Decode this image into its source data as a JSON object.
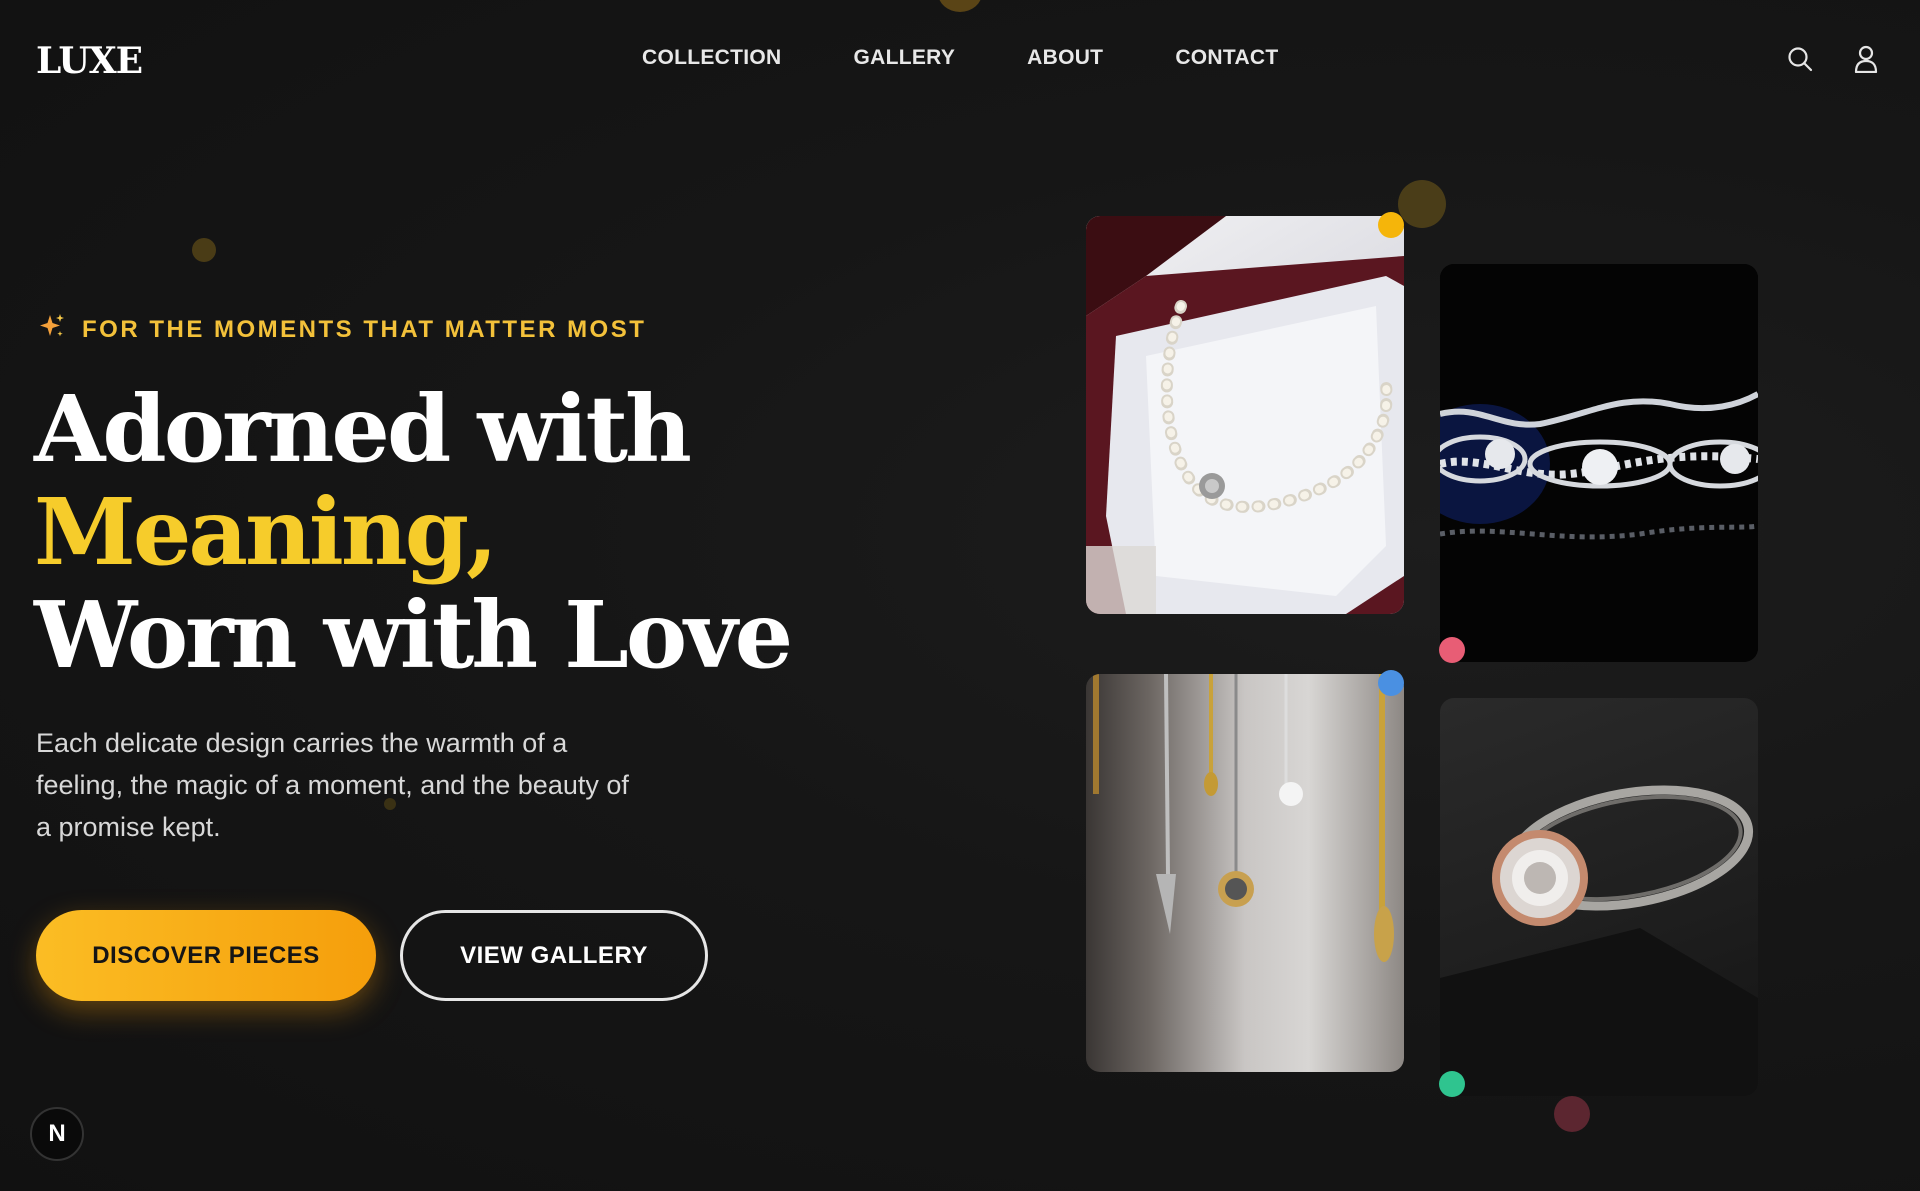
{
  "brand": {
    "logo": "LUXE"
  },
  "nav": {
    "items": [
      {
        "label": "COLLECTION"
      },
      {
        "label": "GALLERY"
      },
      {
        "label": "ABOUT"
      },
      {
        "label": "CONTACT"
      }
    ]
  },
  "header_icons": [
    "search-icon",
    "user-icon"
  ],
  "hero": {
    "tagline": "FOR THE MOMENTS THAT MATTER MOST",
    "tagline_icon": "sparkles-icon",
    "headline_line1": "Adorned with",
    "headline_accent": "Meaning,",
    "headline_line3": "Worn with Love",
    "subtext": "Each delicate design carries the warmth of a feeling, the magic of a moment, and the beauty of a promise kept.",
    "primary_button": "DISCOVER PIECES",
    "secondary_button": "VIEW GALLERY"
  },
  "gallery": {
    "cards": [
      {
        "name": "pearl-necklace-image"
      },
      {
        "name": "diamond-bracelet-image"
      },
      {
        "name": "hanging-pendants-image"
      },
      {
        "name": "rose-gold-ring-image"
      }
    ]
  },
  "dev_badge": {
    "label": "N"
  },
  "colors": {
    "accent": "#f6cc2b",
    "tagline": "#f3c13a",
    "button_gradient_start": "#fbbd24",
    "button_gradient_end": "#f59e0b",
    "background": "#151515"
  }
}
